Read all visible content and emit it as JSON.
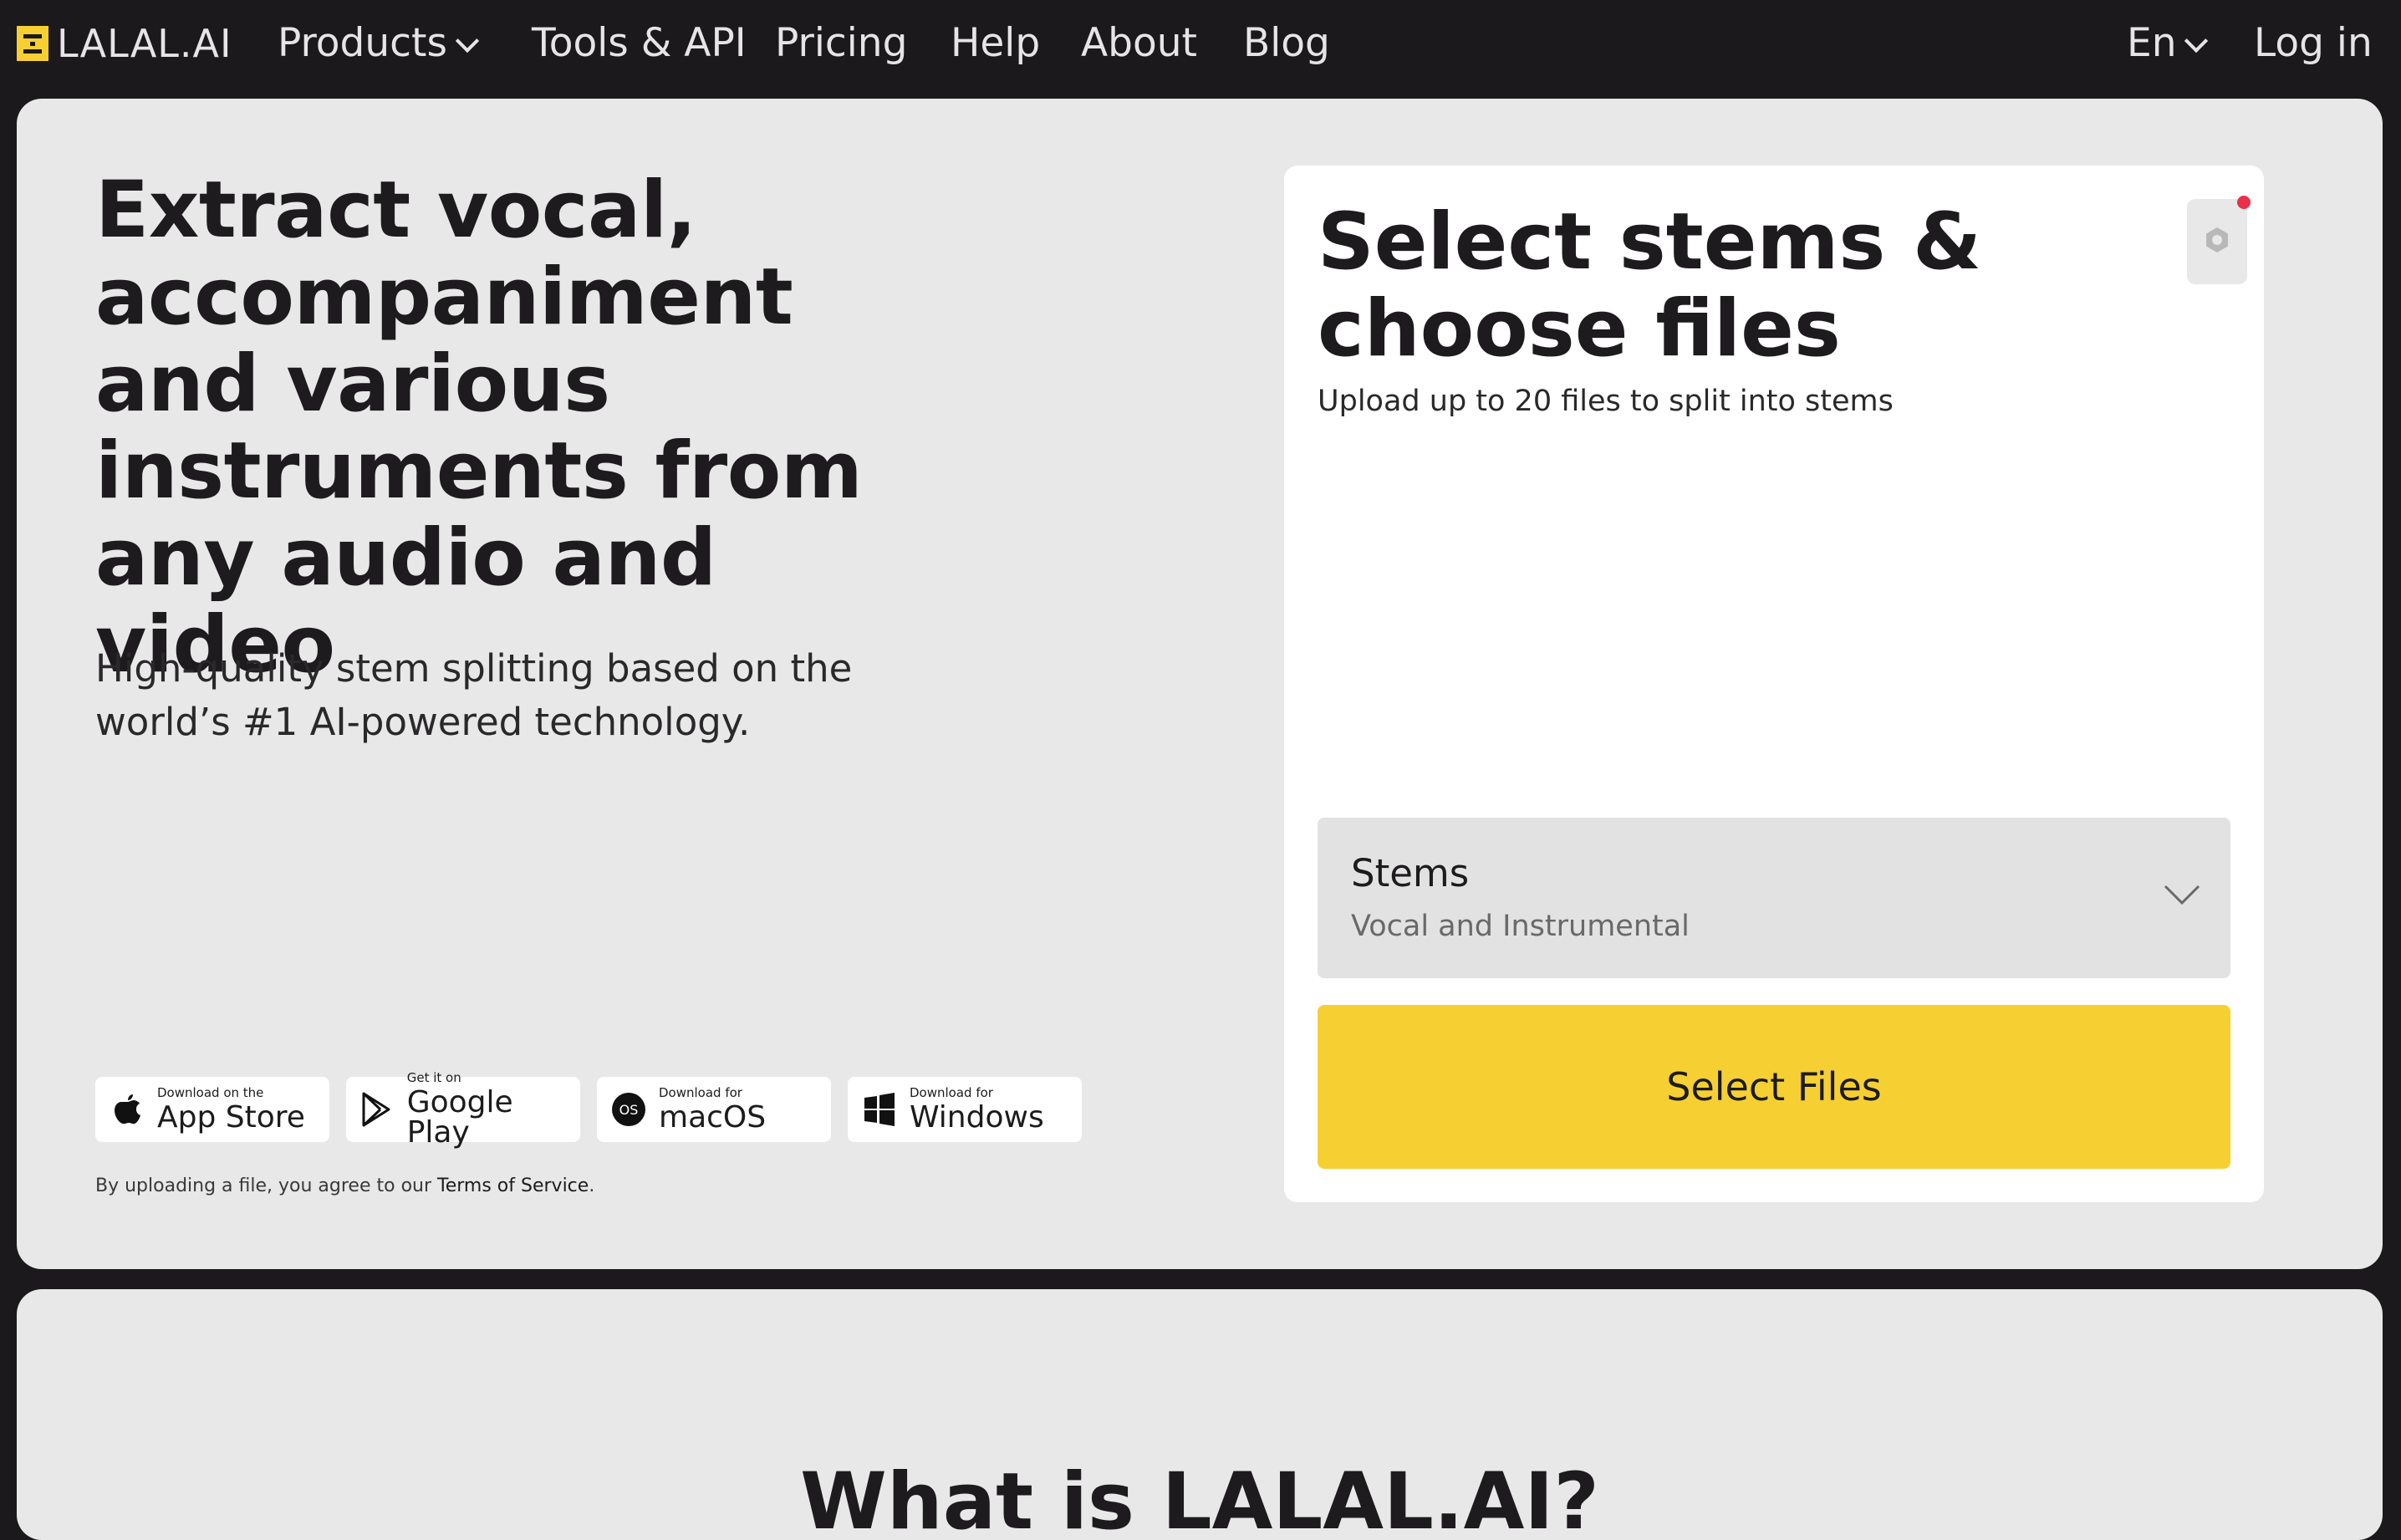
{
  "brand": {
    "name": "LALAL.AI",
    "accent": "#f6d032",
    "bg_dark": "#1b191b"
  },
  "nav": {
    "items": [
      {
        "label": "Products",
        "has_dropdown": true
      },
      {
        "label": "Tools & API"
      },
      {
        "label": "Pricing"
      },
      {
        "label": "Help"
      },
      {
        "label": "About"
      },
      {
        "label": "Blog"
      }
    ],
    "language": "En",
    "login": "Log in"
  },
  "hero": {
    "headline": "Extract vocal, accompaniment and various instruments from any audio and video",
    "subline": "High-quality stem splitting based on the world’s #1 AI-powered technology.",
    "stores": [
      {
        "small": "Download on the",
        "big": "App Store",
        "icon": "apple-icon"
      },
      {
        "small": "Get it on",
        "big": "Google Play",
        "icon": "google-play-icon"
      },
      {
        "small": "Download for",
        "big": "macOS",
        "icon": "macos-icon"
      },
      {
        "small": "Download for",
        "big": "Windows",
        "icon": "windows-icon"
      }
    ],
    "terms_prefix": "By uploading a file, you agree to our ",
    "terms_link": "Terms of Service",
    "terms_suffix": "."
  },
  "upload": {
    "title": "Select stems & choose files",
    "subtitle": "Upload up to 20 files to split into stems",
    "settings_icon": "gear-icon",
    "notification_color": "#e8304a",
    "stems_label": "Stems",
    "stems_value": "Vocal and Instrumental",
    "button": "Select Files"
  },
  "section2": {
    "title": "What is LALAL.AI?"
  }
}
